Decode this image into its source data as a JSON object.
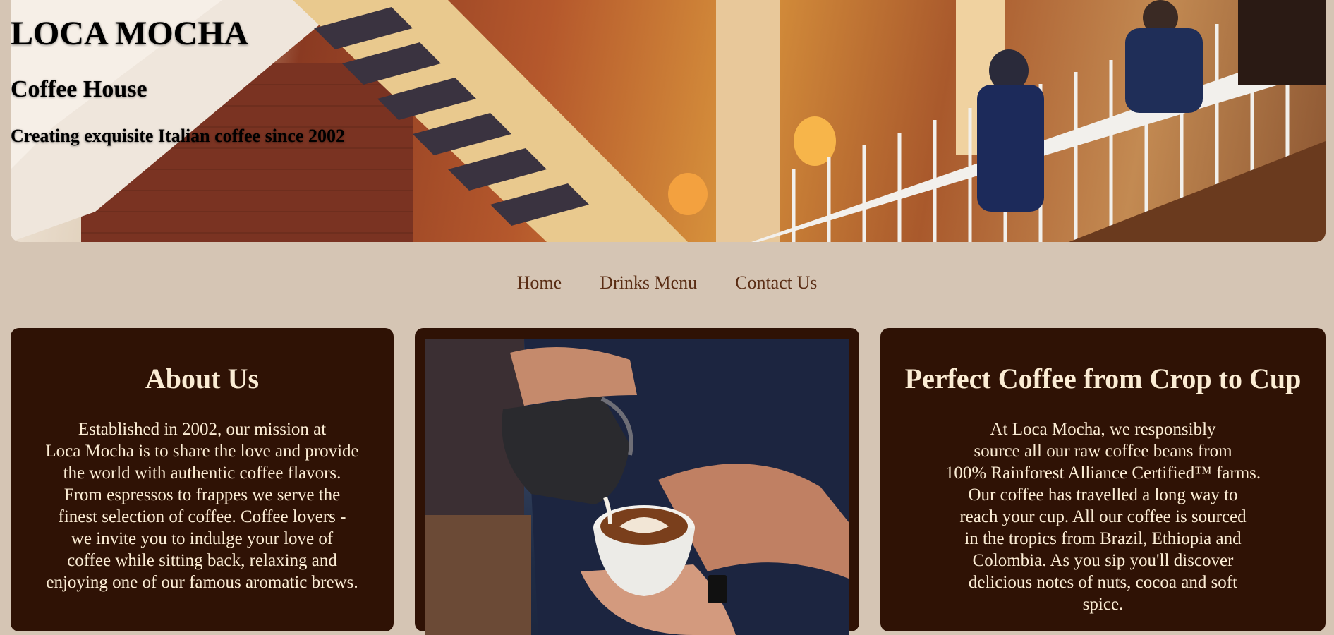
{
  "header": {
    "title": "LOCA MOCHA",
    "subtitle": "Coffee House",
    "tagline": "Creating exquisite Italian coffee since 2002"
  },
  "nav": {
    "items": [
      {
        "label": "Home"
      },
      {
        "label": "Drinks Menu"
      },
      {
        "label": "Contact Us"
      }
    ]
  },
  "about": {
    "title": "About Us",
    "lines": [
      "Established in 2002, our mission at",
      "Loca Mocha is to share the love and provide",
      "the world with authentic coffee flavors.",
      "From espressos to frappes we serve the",
      "finest selection of coffee. Coffee lovers -",
      "we invite you to indulge your love of",
      "coffee while sitting back, relaxing and",
      "enjoying one of our famous aromatic brews."
    ]
  },
  "crop": {
    "title": "Perfect Coffee from Crop to Cup",
    "lines": [
      "At Loca Mocha, we responsibly",
      "source all our raw coffee beans from",
      "100% Rainforest Alliance Certified™ farms.",
      "Our coffee has travelled a long way to",
      "reach your cup. All our coffee is sourced",
      "in the tropics from Brazil, Ethiopia and",
      "Colombia. As you sip you'll discover",
      "delicious notes of nuts, cocoa and soft",
      "spice."
    ]
  },
  "colors": {
    "page_bg": "#d5c5b4",
    "card_bg": "#2f1205",
    "card_text": "#fbecd4",
    "nav_text": "#5a2d14"
  }
}
